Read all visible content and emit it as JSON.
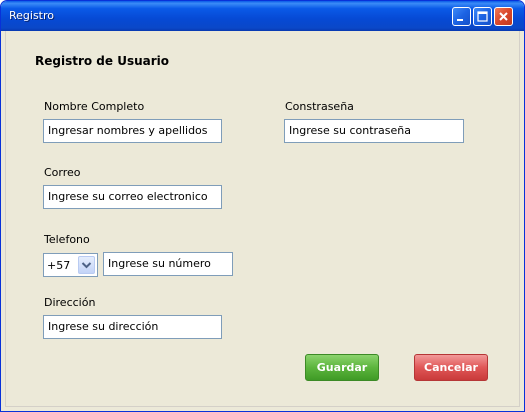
{
  "window": {
    "title": "Registro",
    "controls": {
      "minimize": "minimize-icon",
      "maximize": "maximize-icon",
      "close": "close-icon"
    }
  },
  "form": {
    "heading": "Registro de Usuario",
    "name": {
      "label": "Nombre Completo",
      "placeholder": "Ingresar nombres y apellidos"
    },
    "password": {
      "label": "Constraseña",
      "placeholder": "Ingrese su contraseña"
    },
    "email": {
      "label": "Correo",
      "placeholder": "Ingrese su correo electronico"
    },
    "phone": {
      "label": "Telefono",
      "prefix": "+57",
      "placeholder": "Ingrese su número"
    },
    "address": {
      "label": "Dirección",
      "placeholder": "Ingrese su dirección"
    }
  },
  "actions": {
    "save": "Guardar",
    "cancel": "Cancelar"
  },
  "colors": {
    "titlebar": "#0a5ae8",
    "save": "#5cb53d",
    "cancel": "#e05757",
    "background": "#ece9d8"
  }
}
